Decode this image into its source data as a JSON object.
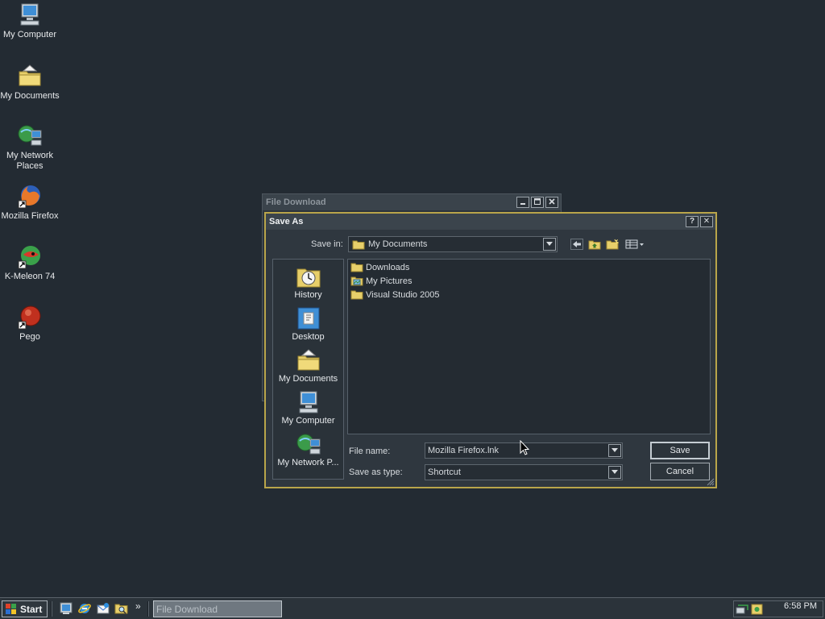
{
  "desktop": {
    "icons": [
      {
        "label": "My Computer",
        "icon": "my-computer-icon"
      },
      {
        "label": "My Documents",
        "icon": "my-documents-icon"
      },
      {
        "label": "My Network Places",
        "icon": "network-places-icon"
      },
      {
        "label": "Mozilla Firefox",
        "icon": "firefox-icon"
      },
      {
        "label": "K-Meleon 74",
        "icon": "kmeleon-icon"
      },
      {
        "label": "Pego",
        "icon": "pego-icon"
      }
    ]
  },
  "bg_window": {
    "title": "File Download"
  },
  "dialog": {
    "title": "Save As",
    "help_label": "?",
    "close_label": "✕",
    "save_in_label": "Save in:",
    "save_in_value": "My Documents",
    "places": [
      {
        "label": "History",
        "icon": "history-icon"
      },
      {
        "label": "Desktop",
        "icon": "desktop-icon"
      },
      {
        "label": "My Documents",
        "icon": "my-documents-icon"
      },
      {
        "label": "My Computer",
        "icon": "my-computer-icon"
      },
      {
        "label": "My Network P...",
        "icon": "network-places-icon"
      }
    ],
    "files": [
      {
        "name": "Downloads",
        "icon": "folder-icon"
      },
      {
        "name": "My Pictures",
        "icon": "pictures-folder-icon"
      },
      {
        "name": "Visual Studio 2005",
        "icon": "folder-icon"
      }
    ],
    "file_name_label": "File name:",
    "file_name_value": "Mozilla Firefox.lnk",
    "save_as_type_label": "Save as type:",
    "save_as_type_value": "Shortcut",
    "save_button": "Save",
    "cancel_button": "Cancel"
  },
  "taskbar": {
    "start_label": "Start",
    "more_label": "»",
    "task_label": "File Download",
    "clock": "6:58 PM"
  },
  "colors": {
    "desktop_bg": "#232b33",
    "dialog_border": "#b9a54a",
    "folder": "#e7cf6a"
  }
}
